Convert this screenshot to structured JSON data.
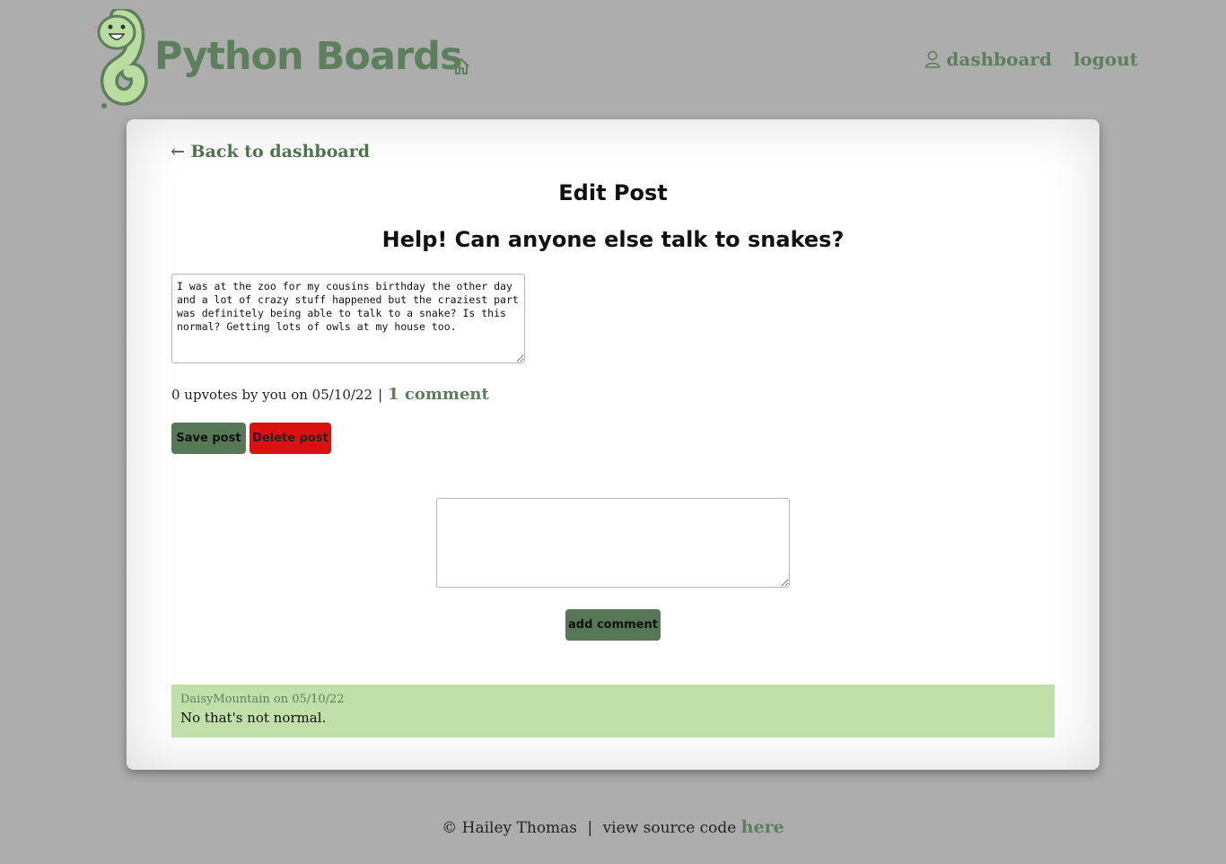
{
  "header": {
    "brand": "Python Boards",
    "nav": {
      "dashboard_label": "dashboard",
      "logout_label": "logout"
    }
  },
  "icons": {
    "logo": "snake-mascot-logo",
    "home": "home-icon",
    "user": "user-icon"
  },
  "main": {
    "back_link": "← Back to dashboard",
    "page_title": "Edit Post",
    "post_title": "Help! Can anyone else talk to snakes?",
    "post_body": "I was at the zoo for my cousins birthday the other day and a lot of crazy stuff happened but the craziest part was definitely being able to talk to a snake? Is this normal? Getting lots of owls at my house too.",
    "meta_text": "0 upvotes by you on 05/10/22",
    "meta_separator": "|",
    "comment_count_link": "1 comment",
    "save_button": "Save post",
    "delete_button": "Delete post",
    "comment_placeholder": "",
    "add_comment_button": "add comment"
  },
  "comments": [
    {
      "meta": "DaisyMountain on 05/10/22",
      "text": "No that's not normal."
    }
  ],
  "footer": {
    "credit": "© Hailey Thomas",
    "separator": "|",
    "source_text": "view source code",
    "source_link": "here"
  },
  "colors": {
    "background": "#adadad",
    "brand_green": "#5e7f5e",
    "button_green": "#567856",
    "danger_red": "#d91111",
    "comment_bg": "#c1dfa9"
  }
}
